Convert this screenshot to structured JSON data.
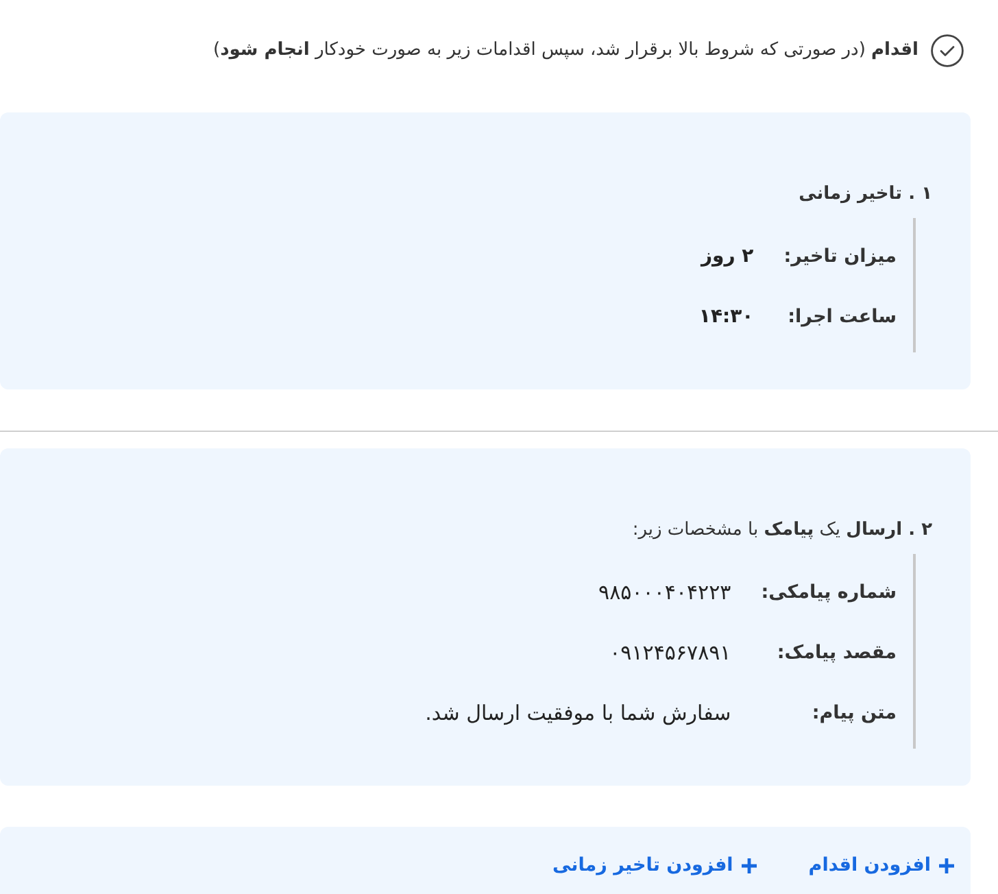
{
  "header": {
    "text": "**اقدام** (در صورتی که شروط بالا برقرار شد، سپس اقدامات زیر به صورت خودکار **انجام شود**)"
  },
  "actions": [
    {
      "kind": "delay",
      "title": "۱ . تاخیر زمانی",
      "fields": [
        {
          "label": "میزان تاخیر:",
          "value": "۲ روز"
        },
        {
          "label": "ساعت اجرا:",
          "value": "۱۴:۳۰"
        }
      ]
    },
    {
      "kind": "sms",
      "title": "**۲ . ارسال** یک **پیامک** با مشخصات زیر:",
      "fields": [
        {
          "label": "شماره پیامکی:",
          "value": "۹۸۵۰۰۰۴۰۴۲۲۳"
        },
        {
          "label": "مقصد پیامک:",
          "value": "۰۹۱۲۴۵۶۷۸۹۱"
        },
        {
          "label": "متن پیام:",
          "value": "سفارش شما با موفقیت ارسال شد."
        }
      ]
    }
  ],
  "buttons": [
    {
      "label": "افزودن اقدام"
    },
    {
      "label": "افزودن تاخیر زمانی"
    }
  ]
}
